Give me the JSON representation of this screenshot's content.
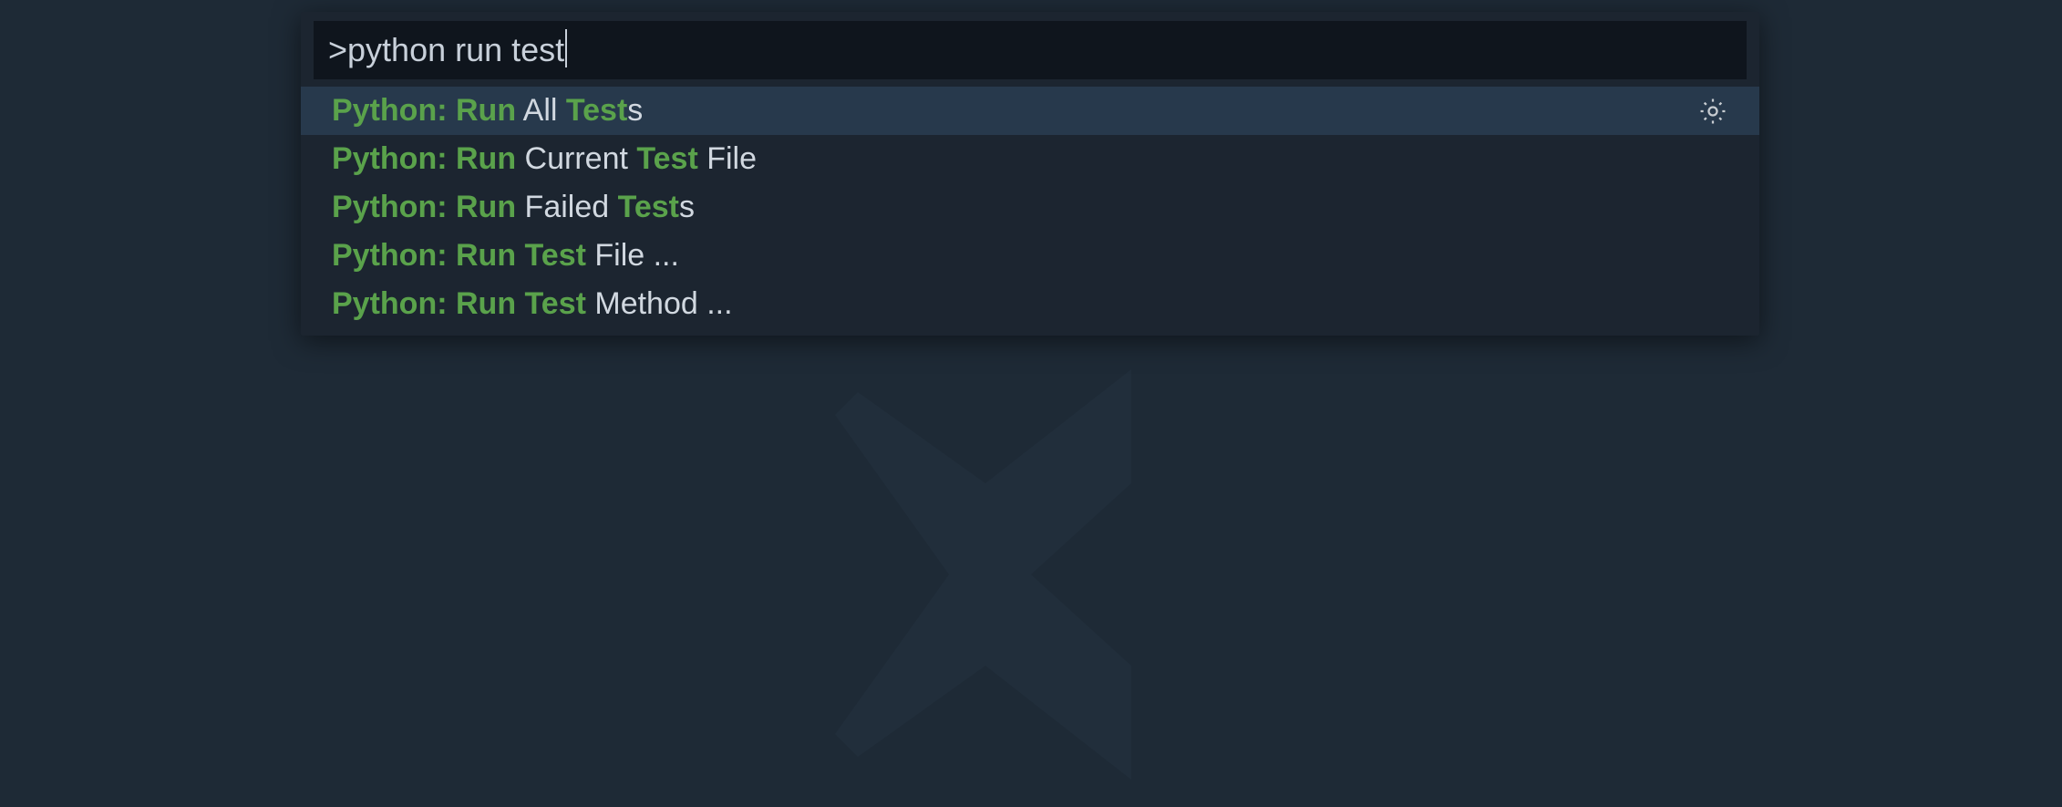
{
  "input": {
    "value": ">python run test"
  },
  "results": [
    {
      "selected": true,
      "has_gear": true,
      "segments": [
        {
          "t": "Python",
          "hl": true
        },
        {
          "t": ": ",
          "hl": true
        },
        {
          "t": "Run",
          "hl": true
        },
        {
          "t": " ",
          "hl": false
        },
        {
          "t": "All ",
          "hl": false
        },
        {
          "t": "Test",
          "hl": true
        },
        {
          "t": "s",
          "hl": false
        }
      ]
    },
    {
      "selected": false,
      "has_gear": false,
      "segments": [
        {
          "t": "Python",
          "hl": true
        },
        {
          "t": ": ",
          "hl": true
        },
        {
          "t": "Run",
          "hl": true
        },
        {
          "t": " ",
          "hl": false
        },
        {
          "t": "Current ",
          "hl": false
        },
        {
          "t": "Test",
          "hl": true
        },
        {
          "t": " File",
          "hl": false
        }
      ]
    },
    {
      "selected": false,
      "has_gear": false,
      "segments": [
        {
          "t": "Python",
          "hl": true
        },
        {
          "t": ": ",
          "hl": true
        },
        {
          "t": "Run",
          "hl": true
        },
        {
          "t": " ",
          "hl": false
        },
        {
          "t": "Failed ",
          "hl": false
        },
        {
          "t": "Test",
          "hl": true
        },
        {
          "t": "s",
          "hl": false
        }
      ]
    },
    {
      "selected": false,
      "has_gear": false,
      "segments": [
        {
          "t": "Python",
          "hl": true
        },
        {
          "t": ": ",
          "hl": true
        },
        {
          "t": "Run",
          "hl": true
        },
        {
          "t": " ",
          "hl": true
        },
        {
          "t": "Test",
          "hl": true
        },
        {
          "t": " File ...",
          "hl": false
        }
      ]
    },
    {
      "selected": false,
      "has_gear": false,
      "segments": [
        {
          "t": "Python",
          "hl": true
        },
        {
          "t": ": ",
          "hl": true
        },
        {
          "t": "Run",
          "hl": true
        },
        {
          "t": " ",
          "hl": true
        },
        {
          "t": "Test",
          "hl": true
        },
        {
          "t": " Method ...",
          "hl": false
        }
      ]
    }
  ]
}
